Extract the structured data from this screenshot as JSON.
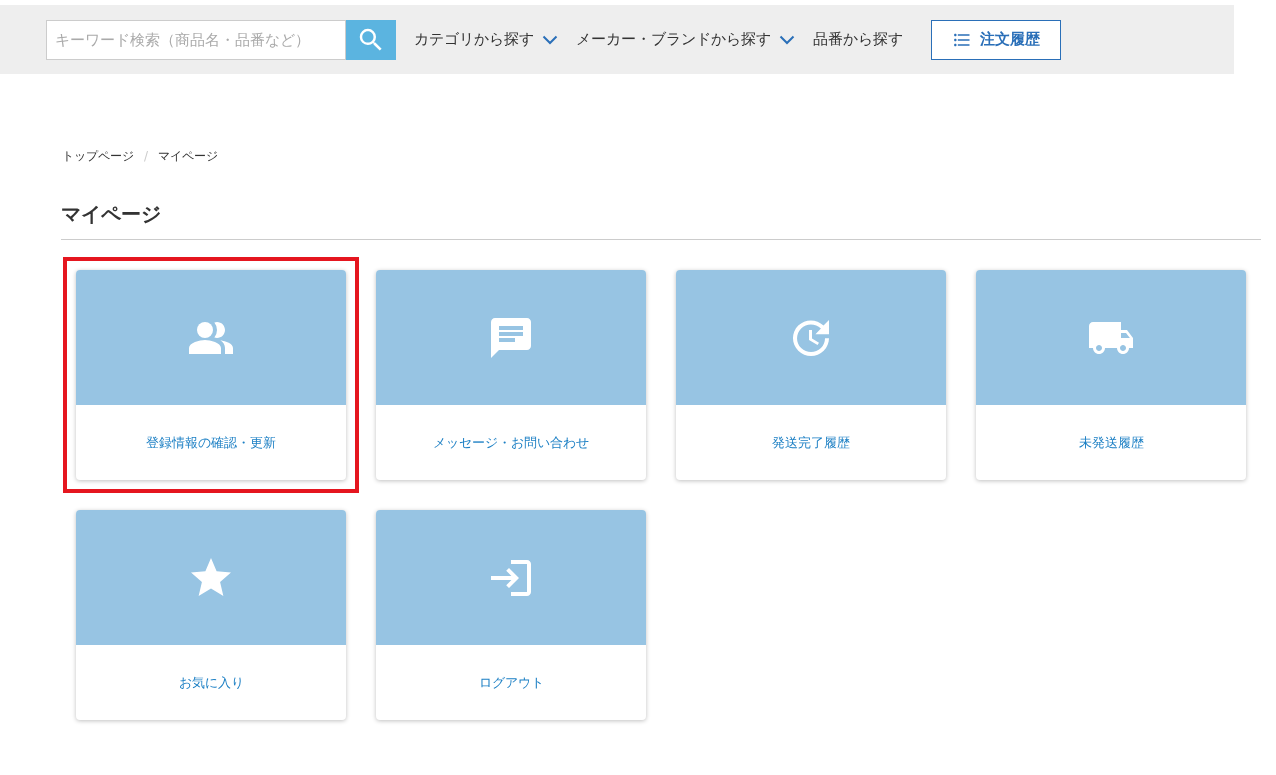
{
  "header": {
    "search": {
      "placeholder": "キーワード検索（商品名・品番など）"
    },
    "nav": [
      {
        "label": "カテゴリから探す",
        "dropdown": true
      },
      {
        "label": "メーカー・ブランドから探す",
        "dropdown": true
      },
      {
        "label": "品番から探す",
        "dropdown": false
      }
    ],
    "order_history_button": "注文履歴"
  },
  "breadcrumb": {
    "separator": "/",
    "items": [
      "トップページ",
      "マイページ"
    ]
  },
  "title": "マイページ",
  "cards": [
    {
      "kind": "people",
      "label": "登録情報の確認・更新",
      "highlighted": true
    },
    {
      "kind": "message",
      "label": "メッセージ・お問い合わせ",
      "highlighted": false
    },
    {
      "kind": "history",
      "label": "発送完了履歴",
      "highlighted": false
    },
    {
      "kind": "truck",
      "label": "未発送履歴",
      "highlighted": false
    },
    {
      "kind": "star",
      "label": "お気に入り",
      "highlighted": false
    },
    {
      "kind": "logout",
      "label": "ログアウト",
      "highlighted": false
    }
  ]
}
